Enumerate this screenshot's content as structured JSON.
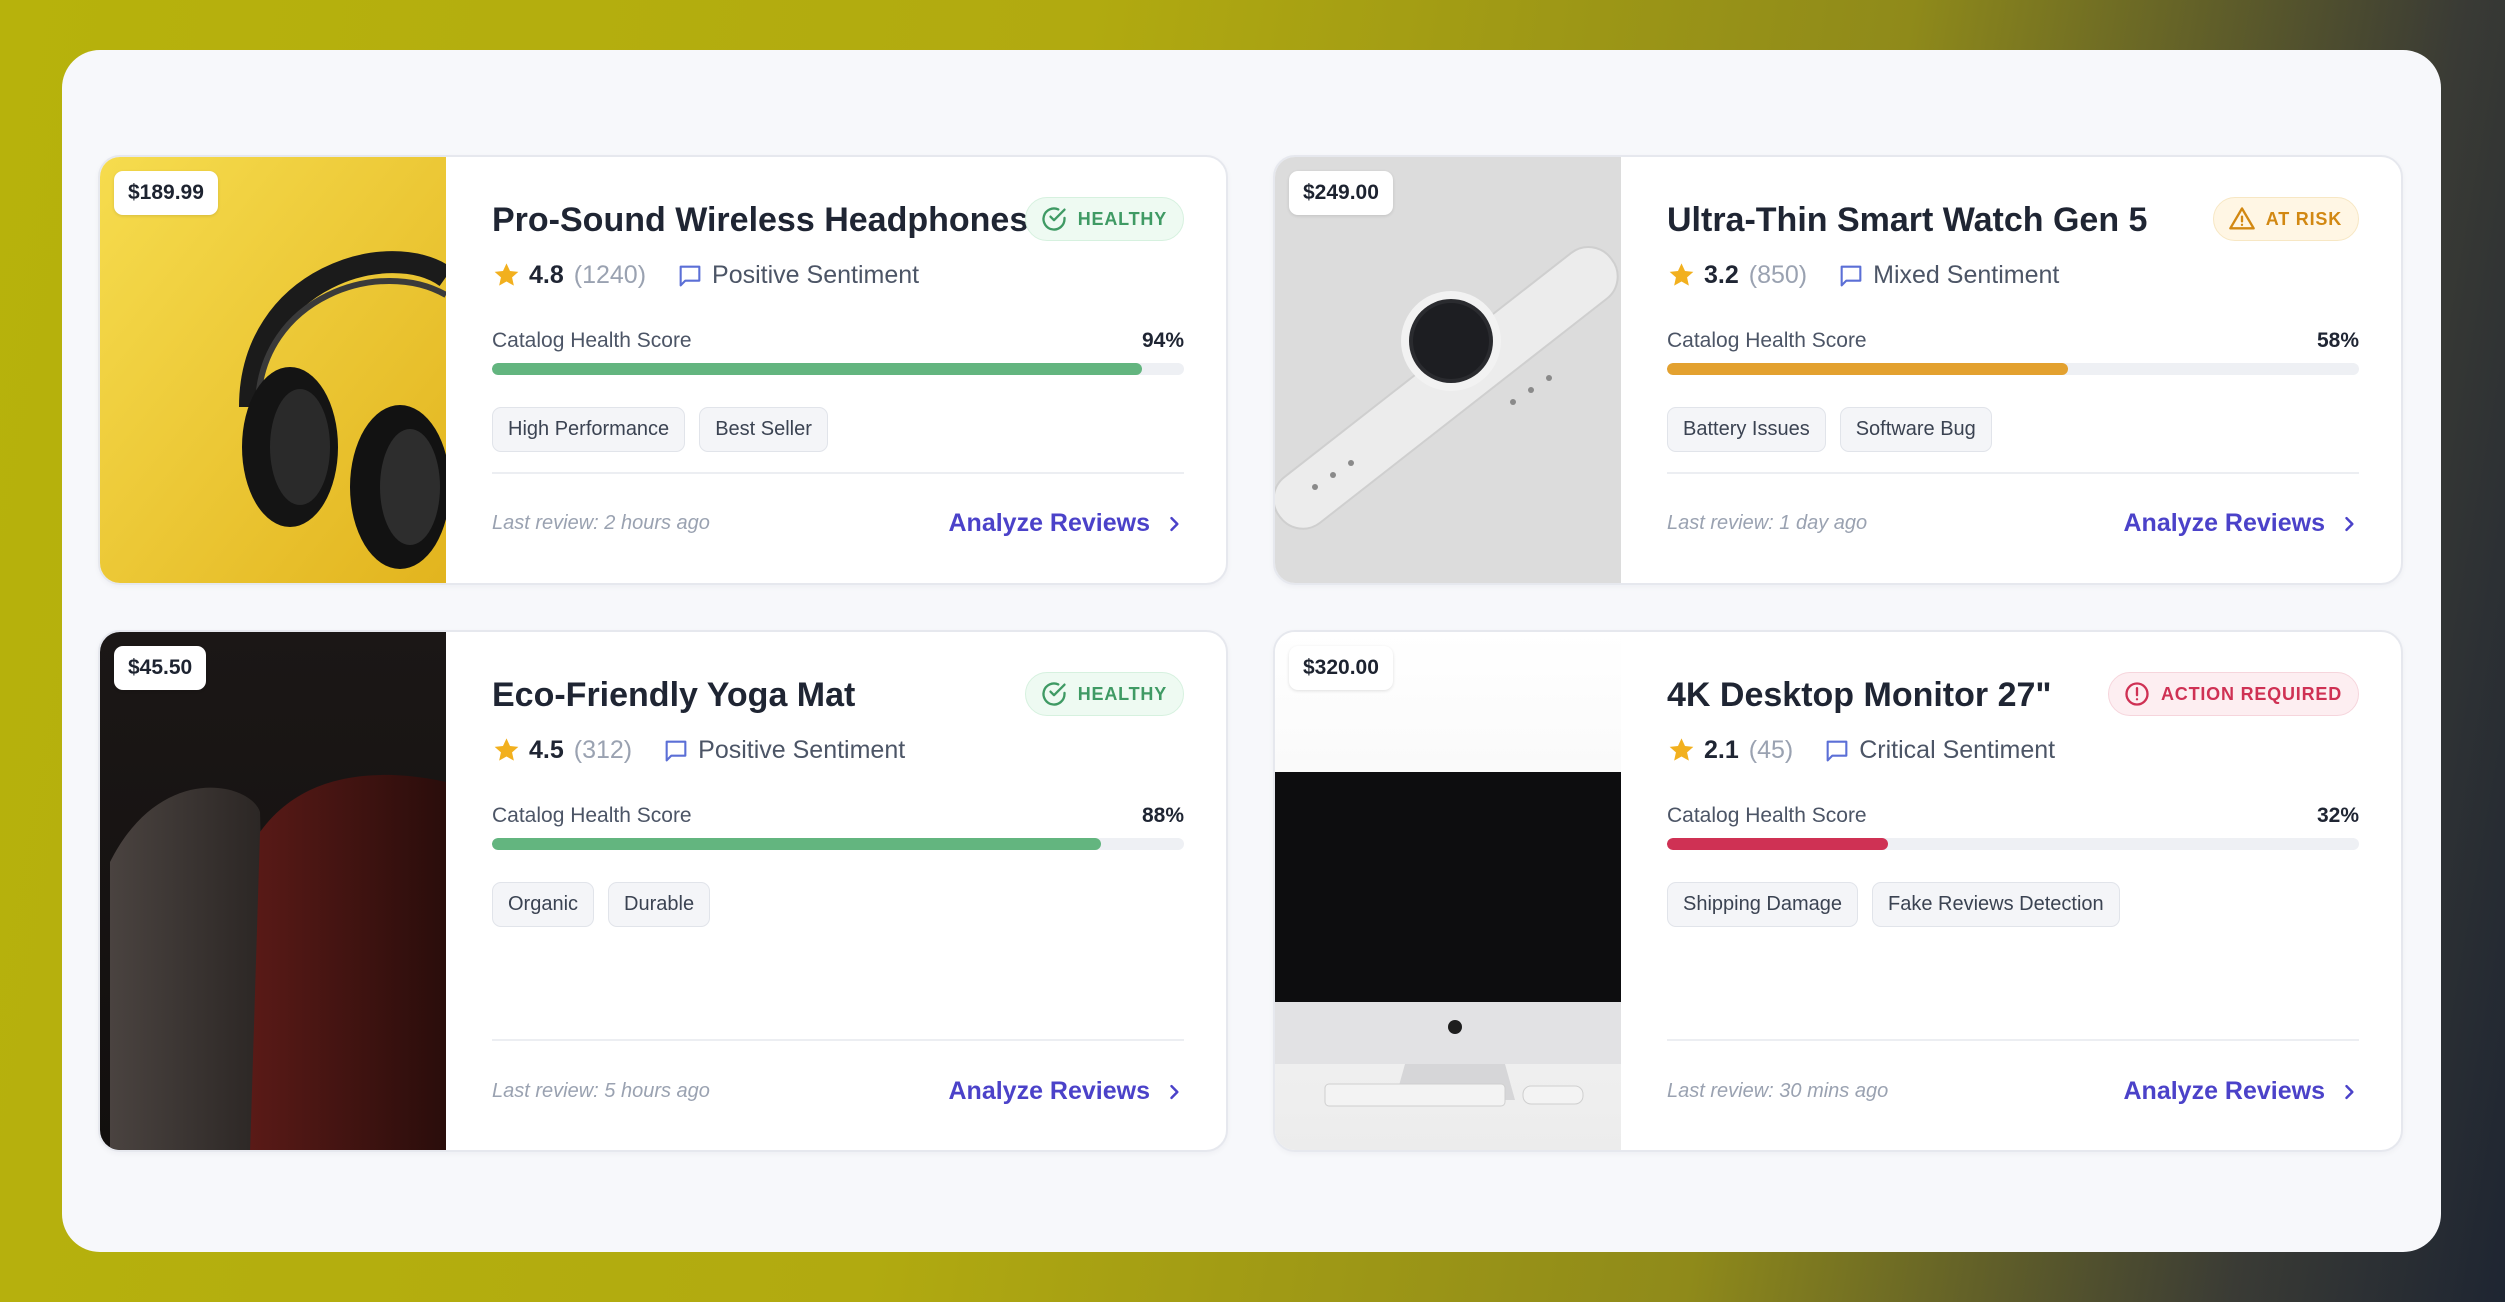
{
  "products": [
    {
      "price": "$189.99",
      "name": "Pro-Sound Wireless Headphones",
      "status": "HEALTHY",
      "rating": "4.8",
      "reviews": "(1240)",
      "sentiment": "Positive Sentiment",
      "score_label": "Catalog Health Score",
      "score_pct": "94%",
      "score_value": 0.94,
      "bar_color": "#63b57f",
      "tags": [
        "High Performance",
        "Best Seller"
      ],
      "last_review": "Last review: 2 hours ago",
      "action": "Analyze Reviews",
      "image": "headphones-photo"
    },
    {
      "price": "$249.00",
      "name": "Ultra-Thin Smart Watch Gen 5",
      "status": "AT RISK",
      "rating": "3.2",
      "reviews": "(850)",
      "sentiment": "Mixed Sentiment",
      "score_label": "Catalog Health Score",
      "score_pct": "58%",
      "score_value": 0.58,
      "bar_color": "#e3a12f",
      "tags": [
        "Battery Issues",
        "Software Bug"
      ],
      "last_review": "Last review: 1 day ago",
      "action": "Analyze Reviews",
      "image": "smart-watch-photo"
    },
    {
      "price": "$45.50",
      "name": "Eco-Friendly Yoga Mat",
      "status": "HEALTHY",
      "rating": "4.5",
      "reviews": "(312)",
      "sentiment": "Positive Sentiment",
      "score_label": "Catalog Health Score",
      "score_pct": "88%",
      "score_value": 0.88,
      "bar_color": "#63b57f",
      "tags": [
        "Organic",
        "Durable"
      ],
      "last_review": "Last review: 5 hours ago",
      "action": "Analyze Reviews",
      "image": "yoga-mat-photo"
    },
    {
      "price": "$320.00",
      "name": "4K Desktop Monitor 27\"",
      "status": "ACTION REQUIRED",
      "rating": "2.1",
      "reviews": "(45)",
      "sentiment": "Critical Sentiment",
      "score_label": "Catalog Health Score",
      "score_pct": "32%",
      "score_value": 0.32,
      "bar_color": "#cf3154",
      "tags": [
        "Shipping Damage",
        "Fake Reviews Detection"
      ],
      "last_review": "Last review: 30 mins ago",
      "action": "Analyze Reviews",
      "image": "desktop-monitor-photo"
    }
  ],
  "colors": {
    "healthy": "#3f9a64",
    "at_risk": "#d28812",
    "action_required": "#cf3154",
    "accent": "#4b42c9",
    "star": "#f2b01e"
  },
  "icons": {
    "healthy": "check-circle-icon",
    "at_risk": "warning-triangle-icon",
    "action_required": "alert-circle-icon",
    "sentiment": "chat-bubble-icon",
    "rating": "star-icon",
    "action": "chevron-right-icon"
  }
}
